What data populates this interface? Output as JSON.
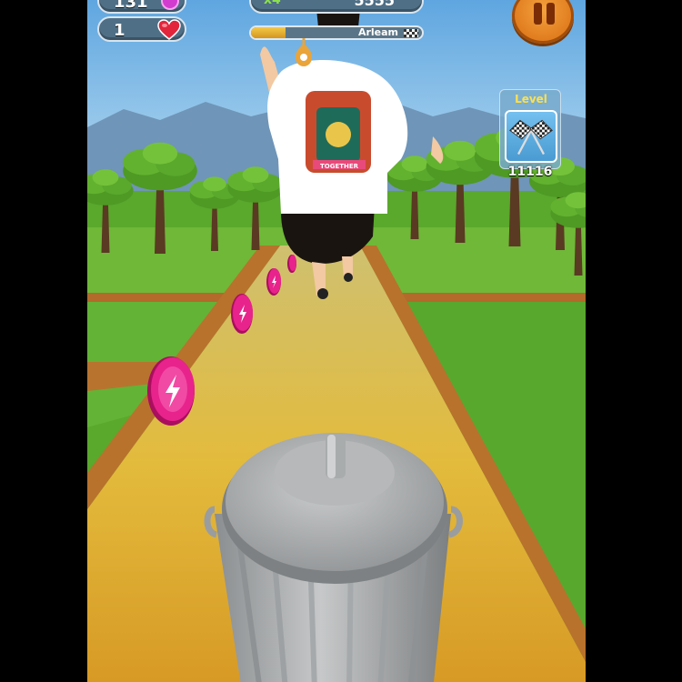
{
  "hud": {
    "coins": "131",
    "lives": "1",
    "score_multiplier": "x4",
    "score": "5555",
    "player_name": "Arleam",
    "level_label": "Level",
    "level_number": "11116",
    "progress_fraction": 0.2
  },
  "icons": {
    "coin": "coin-icon",
    "heart": "heart-icon",
    "pause": "pause-icon",
    "finish": "checkered-flags-icon",
    "pickup": "lightning-coin-icon",
    "obstacle": "trash-can",
    "marker": "location-pin-icon"
  },
  "shirt_print": "TOGETHER",
  "colors": {
    "sky_top": "#5fa6e0",
    "path": "#e0b83d",
    "grass": "#5aa82c",
    "coin_pink": "#e8238c",
    "pause_orange": "#ef8a24",
    "hud_blue": "#4f6f86"
  }
}
